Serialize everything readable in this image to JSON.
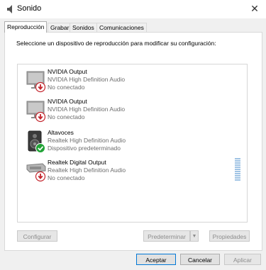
{
  "window": {
    "title": "Sonido",
    "close_glyph": "✕"
  },
  "tabs": [
    {
      "label": "Reproducción",
      "active": true
    },
    {
      "label": "Grabar"
    },
    {
      "label": "Sonidos"
    },
    {
      "label": "Comunicaciones"
    }
  ],
  "instruction": "Seleccione un dispositivo de reproducción para modificar su configuración:",
  "devices": [
    {
      "name": "NVIDIA Output",
      "driver": "NVIDIA High Definition Audio",
      "status": "No conectado",
      "icon": "monitor-icon",
      "badge": "disconnected-badge-icon"
    },
    {
      "name": "NVIDIA Output",
      "driver": "NVIDIA High Definition Audio",
      "status": "No conectado",
      "icon": "monitor-icon",
      "badge": "disconnected-badge-icon"
    },
    {
      "name": "Altavoces",
      "driver": "Realtek High Definition Audio",
      "status": "Dispositivo predeterminado",
      "icon": "speaker-icon",
      "badge": "default-check-badge-icon"
    },
    {
      "name": "Realtek Digital Output",
      "driver": "Realtek High Definition Audio",
      "status": "No conectado",
      "icon": "digital-output-icon",
      "badge": "disconnected-badge-icon"
    }
  ],
  "buttons": {
    "configure": "Configurar",
    "set_default": "Predeterminar",
    "split_arrow": "▼",
    "properties": "Propiedades",
    "accept": "Aceptar",
    "cancel": "Cancelar",
    "apply": "Aplicar"
  },
  "colors": {
    "accent": "#0078d7",
    "disconnected": "#c4262e",
    "default_check": "#21a336",
    "level_meter": "#9fc3e4"
  }
}
